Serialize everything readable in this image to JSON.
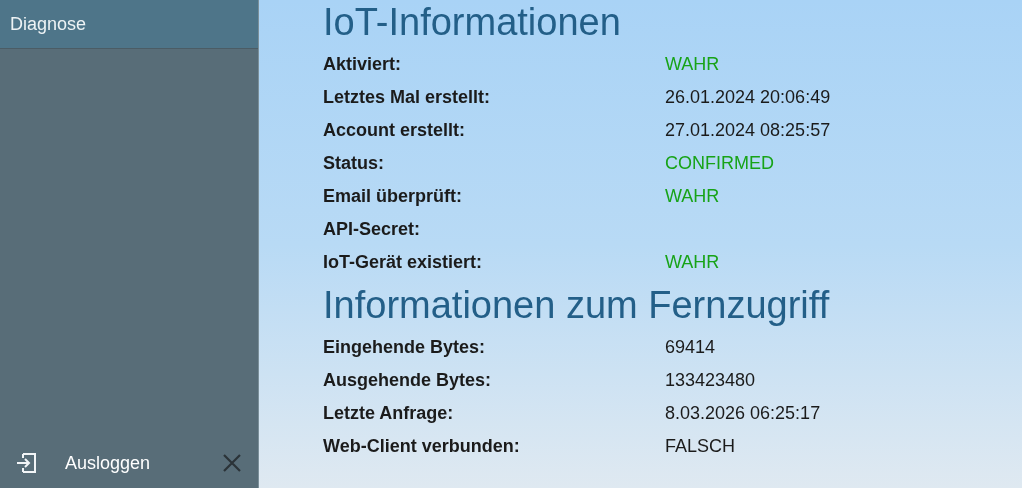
{
  "sidebar": {
    "items": [
      {
        "label": "Diagnose",
        "selected": true
      }
    ],
    "logout": {
      "label": "Ausloggen"
    }
  },
  "sections": [
    {
      "title": "IoT-Informationen",
      "rows": [
        {
          "label": "Aktiviert:",
          "value": "WAHR",
          "kind": "success"
        },
        {
          "label": "Letztes Mal erstellt:",
          "value": "26.01.2024 20:06:49",
          "kind": "text"
        },
        {
          "label": "Account erstellt:",
          "value": "27.01.2024 08:25:57",
          "kind": "text"
        },
        {
          "label": "Status:",
          "value": "CONFIRMED",
          "kind": "success"
        },
        {
          "label": "Email überprüft:",
          "value": "WAHR",
          "kind": "success"
        },
        {
          "label": "API-Secret:"
        },
        {
          "label": "IoT-Gerät existiert:",
          "value": "WAHR",
          "kind": "success"
        }
      ]
    },
    {
      "title": "Informationen zum Fernzugriff",
      "rows": [
        {
          "label": "Eingehende Bytes:",
          "value": "69414",
          "kind": "text"
        },
        {
          "label": "Ausgehende Bytes:",
          "value": "133423480",
          "kind": "text"
        },
        {
          "label": "Letzte Anfrage:",
          "value": "8.03.2026 06:25:17",
          "kind": "text"
        },
        {
          "label": "Web-Client verbunden:",
          "value": "FALSCH",
          "kind": "text"
        }
      ]
    }
  ]
}
